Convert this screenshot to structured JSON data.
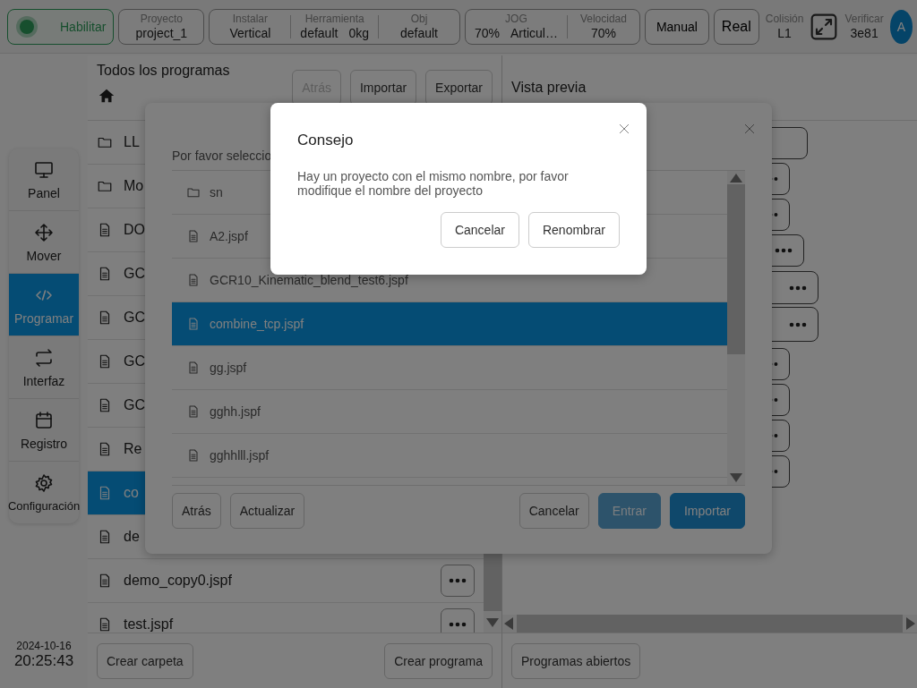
{
  "top_bar": {
    "enable_button": "Habilitar",
    "project": {
      "label": "Proyecto",
      "value": "project_1"
    },
    "setup": [
      {
        "label": "Instalar",
        "values": [
          "Vertical"
        ]
      },
      {
        "label": "Herramienta",
        "values": [
          "default",
          "0kg"
        ]
      },
      {
        "label": "Obj",
        "values": [
          "default"
        ]
      }
    ],
    "jog": [
      {
        "label": "JOG",
        "values": [
          "70%",
          "Articul…"
        ]
      },
      {
        "label": "Velocidad",
        "values": [
          "70%"
        ]
      }
    ],
    "mode_buttons": [
      "Manual",
      "Real"
    ],
    "collision": {
      "label": "Colisión",
      "value": "L1"
    },
    "verify": {
      "label": "Verificar",
      "value": "3e81"
    },
    "avatar": "A"
  },
  "sidebar": {
    "items": [
      {
        "kind": "monitor",
        "label": "Panel",
        "selected": false
      },
      {
        "kind": "move",
        "label": "Mover",
        "selected": false
      },
      {
        "kind": "code",
        "label": "Programar",
        "selected": true
      },
      {
        "kind": "swap",
        "label": "Interfaz",
        "selected": false
      },
      {
        "kind": "calendar",
        "label": "Registro",
        "selected": false
      },
      {
        "kind": "gear",
        "label": "Configuración",
        "selected": false
      }
    ],
    "date": "2024-10-16",
    "time": "20:25:43"
  },
  "programs": {
    "title": "Todos los programas",
    "buttons": [
      {
        "label": "Atrás",
        "disabled": true
      },
      {
        "label": "Importar",
        "disabled": false
      },
      {
        "label": "Exportar",
        "disabled": false
      }
    ],
    "items": [
      {
        "kind": "folder",
        "name": "LL",
        "selected": false
      },
      {
        "kind": "folder",
        "name": "Mo",
        "selected": false
      },
      {
        "kind": "file",
        "name": "DO",
        "selected": false
      },
      {
        "kind": "file",
        "name": "GC",
        "selected": false
      },
      {
        "kind": "file",
        "name": "GC",
        "selected": false
      },
      {
        "kind": "file",
        "name": "GC",
        "selected": false
      },
      {
        "kind": "file",
        "name": "GC",
        "selected": false
      },
      {
        "kind": "file",
        "name": "Re",
        "selected": false
      },
      {
        "kind": "file",
        "name": "co",
        "selected": true
      },
      {
        "kind": "file",
        "name": "de",
        "selected": false
      },
      {
        "kind": "file",
        "name": "demo_copy0.jspf",
        "selected": false,
        "menu": true
      },
      {
        "kind": "file",
        "name": "test.jspf",
        "selected": false,
        "menu": true
      }
    ],
    "footer_buttons": [
      "Crear carpeta",
      "Crear programa"
    ]
  },
  "preview": {
    "title": "Vista previa",
    "nodes": [
      {
        "menu": false
      },
      {
        "menu": true
      },
      {
        "menu": true
      },
      {
        "menu": true
      },
      {
        "menu": true
      },
      {
        "menu": true
      },
      {
        "menu": true
      },
      {
        "menu": true
      },
      {
        "menu": true
      },
      {
        "menu": true
      }
    ],
    "footer_button": "Programas abiertos"
  },
  "import_dialog": {
    "prompt": "Por favor seleccio",
    "files": [
      {
        "kind": "folder",
        "name": "sn",
        "selected": false
      },
      {
        "kind": "file",
        "name": "A2.jspf",
        "selected": false
      },
      {
        "kind": "file",
        "name": "GCR10_Kinematic_blend_test6.jspf",
        "selected": false
      },
      {
        "kind": "file",
        "name": "combine_tcp.jspf",
        "selected": true
      },
      {
        "kind": "file",
        "name": "gg.jspf",
        "selected": false
      },
      {
        "kind": "file",
        "name": "gghh.jspf",
        "selected": false
      },
      {
        "kind": "file",
        "name": "gghhlll.jspf",
        "selected": false
      }
    ],
    "left_buttons": [
      "Atrás",
      "Actualizar"
    ],
    "buttons": [
      {
        "label": "Cancelar",
        "kind": "default",
        "disabled": false
      },
      {
        "label": "Entrar",
        "kind": "primary",
        "disabled": true
      },
      {
        "label": "Importar",
        "kind": "primary",
        "disabled": false
      }
    ]
  },
  "tip_dialog": {
    "title": "Consejo",
    "message": "Hay un proyecto con el mismo nombre, por favor modifique el nombre del proyecto",
    "buttons": [
      "Cancelar",
      "Renombrar"
    ]
  }
}
